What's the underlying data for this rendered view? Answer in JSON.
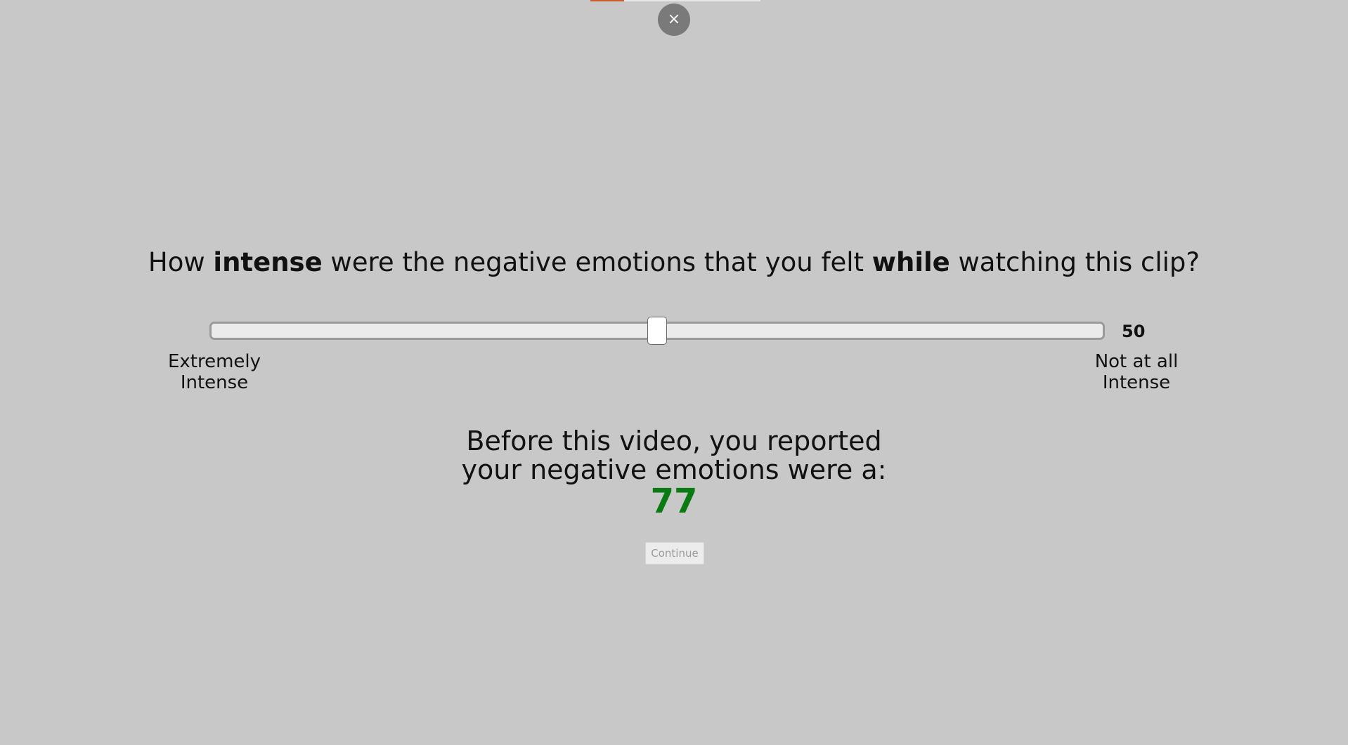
{
  "progress": {
    "fraction": 0.2,
    "fill_color": "#c8602e"
  },
  "close_button": {
    "icon": "close-icon",
    "glyph": "×"
  },
  "question": {
    "part1": "How ",
    "bold1": "intense",
    "part2": " were the negative emotions that you felt ",
    "bold2": "while",
    "part3": " watching this clip?"
  },
  "slider": {
    "value": 50,
    "min": 0,
    "max": 100,
    "value_label": "50",
    "left_label_line1": "Extremely",
    "left_label_line2": "Intense",
    "right_label_line1": "Not at all",
    "right_label_line2": "Intense"
  },
  "previous_report": {
    "line1": "Before this video, you reported",
    "line2": "your negative emotions were a:",
    "value": "77",
    "value_color": "#0a7a12"
  },
  "continue_button": {
    "label": "Continue",
    "disabled": true
  }
}
